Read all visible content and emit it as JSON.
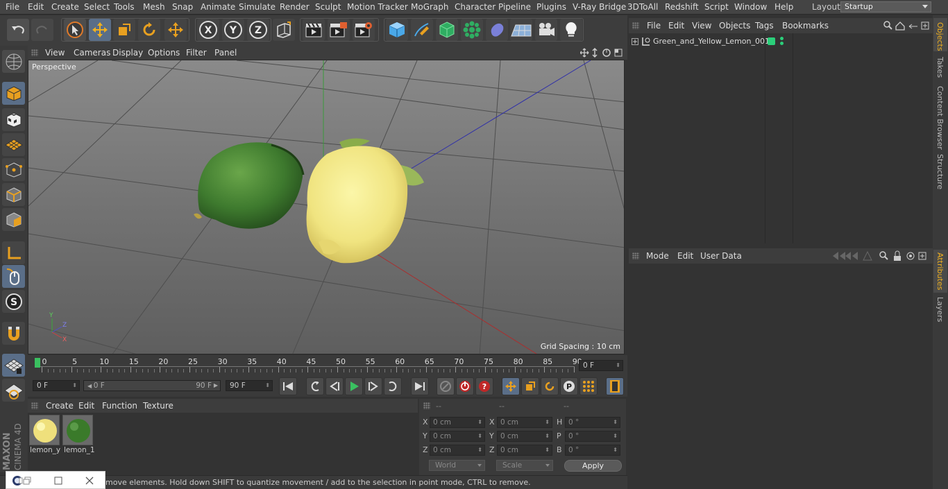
{
  "menubar": {
    "items": [
      "File",
      "Edit",
      "Create",
      "Select",
      "Tools",
      "Mesh",
      "Snap",
      "Animate",
      "Simulate",
      "Render",
      "Sculpt",
      "Motion Tracker",
      "MoGraph",
      "Character",
      "Pipeline",
      "Plugins",
      "V-Ray Bridge",
      "3DToAll",
      "Redshift",
      "Script",
      "Window",
      "Help"
    ],
    "layout_label": "Layout:",
    "layout_value": "Startup"
  },
  "toolbar": {
    "icons": [
      "undo-icon",
      "redo-icon",
      "select-arrow-icon",
      "move-icon",
      "scale-icon",
      "rotate-icon",
      "live-move-icon",
      "x-axis-icon",
      "y-axis-icon",
      "z-axis-icon",
      "coordinate-system-icon",
      "render-view-icon",
      "render-picture-viewer-icon",
      "render-settings-icon",
      "cube-primitive-icon",
      "pen-spline-icon",
      "subdivision-icon",
      "cloner-icon",
      "deformer-icon",
      "floor-icon",
      "camera-icon",
      "light-icon"
    ],
    "axis_labels": [
      "X",
      "Y",
      "Z"
    ]
  },
  "viewport": {
    "menu": [
      "View",
      "Cameras",
      "Display",
      "Options",
      "Filter",
      "Panel"
    ],
    "camera_label": "Perspective",
    "grid_spacing": "Grid Spacing : 10 cm",
    "axis_x": "X",
    "axis_y": "Y",
    "axis_z": "Z"
  },
  "timeline": {
    "ticks": [
      "0",
      "5",
      "10",
      "15",
      "20",
      "25",
      "30",
      "35",
      "40",
      "45",
      "50",
      "55",
      "60",
      "65",
      "70",
      "75",
      "80",
      "85",
      "90"
    ],
    "current_frame": "0 F",
    "start_frame": "0 F",
    "range_start": "0 F",
    "range_end": "90 F",
    "end_frame": "90 F"
  },
  "materials": {
    "menu": [
      "Create",
      "Edit",
      "Function",
      "Texture"
    ],
    "items": [
      {
        "label": "lemon_y"
      },
      {
        "label": "lemon_1"
      }
    ]
  },
  "coords": {
    "headers": [
      "--",
      "--",
      "--"
    ],
    "pos": [
      {
        "axis": "X",
        "value": "0 cm"
      },
      {
        "axis": "Y",
        "value": "0 cm"
      },
      {
        "axis": "Z",
        "value": "0 cm"
      }
    ],
    "size": [
      {
        "axis": "X",
        "value": "0 cm"
      },
      {
        "axis": "Y",
        "value": "0 cm"
      },
      {
        "axis": "Z",
        "value": "0 cm"
      }
    ],
    "rot": [
      {
        "axis": "H",
        "value": "0 °"
      },
      {
        "axis": "P",
        "value": "0 °"
      },
      {
        "axis": "B",
        "value": "0 °"
      }
    ],
    "world": "World",
    "scale": "Scale",
    "apply": "Apply"
  },
  "objects": {
    "menu": [
      "File",
      "Edit",
      "View",
      "Objects",
      "Tags",
      "Bookmarks"
    ],
    "items": [
      {
        "name": "Green_and_Yellow_Lemon_001",
        "tag_color": "#2bcf7a"
      }
    ]
  },
  "attributes": {
    "menu": [
      "Mode",
      "Edit",
      "User Data"
    ]
  },
  "right_tabs": {
    "top": [
      "Objects",
      "Takes",
      "Content Browser",
      "Structure"
    ],
    "bottom": [
      "Attributes",
      "Layers"
    ]
  },
  "status": {
    "text": "move elements. Hold down SHIFT to quantize movement / add to the selection in point mode, CTRL to remove."
  },
  "branding": {
    "maxon": "MAXON",
    "cinema": "CINEMA 4D"
  }
}
